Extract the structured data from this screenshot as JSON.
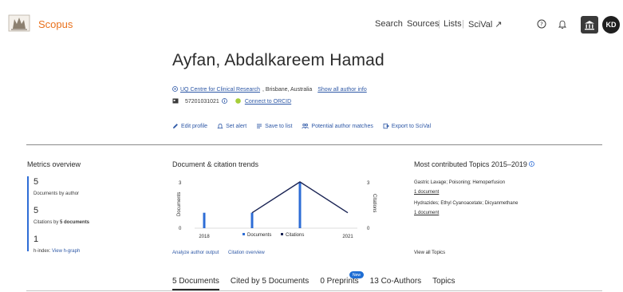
{
  "header": {
    "logo_text": "Scopus",
    "nav": [
      {
        "label": "Search"
      },
      {
        "label": "Sources"
      },
      {
        "label": "Lists"
      },
      {
        "label": "SciVal ↗"
      }
    ],
    "avatar_initials": "KD",
    "accent_color": "#e9711c",
    "icons": [
      "help-icon",
      "bell-icon",
      "institution-icon"
    ]
  },
  "author": {
    "name": "Ayfan, Abdalkareem Hamad",
    "affiliation_link": "UQ Centre for Clinical Research",
    "affiliation_place": ", Brisbane, Australia",
    "show_all_info": "Show all author info",
    "author_id": "57201031021",
    "orcid": "Connect to ORCID"
  },
  "actions": {
    "edit": "Edit profile",
    "alert": "Set alert",
    "save": "Save to list",
    "matches": "Potential author matches",
    "export": "Export to SciVal"
  },
  "metrics": {
    "title": "Metrics overview",
    "docs_value": "5",
    "docs_label": "Documents by author",
    "cites_value": "5",
    "cites_label_prefix": "Citations by ",
    "cites_label_bold": "5 documents",
    "h_value": "1",
    "h_label": "h-index:",
    "h_link": "View h-graph"
  },
  "trends": {
    "title": "Document & citation trends",
    "analyze_link": "Analyze author output",
    "citation_link": "Citation overview"
  },
  "chart_data": {
    "type": "bar",
    "categories": [
      "2018",
      "2019",
      "2020",
      "2021"
    ],
    "series": [
      {
        "name": "Documents",
        "values": [
          1,
          1,
          3,
          0
        ],
        "color": "#2e6dd6"
      },
      {
        "name": "Citations",
        "values": [
          0,
          1,
          3,
          1
        ],
        "color": "#1a2454"
      }
    ],
    "x_tick_labels": [
      "2018",
      "2021"
    ],
    "ylabel": "Documents",
    "y2label": "Citations",
    "ylim": [
      0,
      3
    ],
    "y2lim": [
      0,
      3
    ],
    "y_ticks": [
      "3",
      "0"
    ],
    "y2_ticks": [
      "3",
      "0"
    ],
    "legend": "bottom"
  },
  "topics": {
    "title": "Most contributed Topics 2015–2019",
    "items": [
      {
        "name": "Gastric Lavage; Poisoning; Hemoperfusion",
        "docs": "1 document"
      },
      {
        "name": "Hydrazides; Ethyl Cyanoacetate; Dicyanmethane",
        "docs": "1 document"
      }
    ],
    "view_all": "View all Topics"
  },
  "tabs": [
    {
      "label": "5 Documents",
      "active": true
    },
    {
      "label": "Cited by 5 Documents",
      "active": false
    },
    {
      "label": "0 Preprints",
      "active": false
    },
    {
      "label": "13 Co-Authors",
      "active": false
    },
    {
      "label": "Topics",
      "active": false
    }
  ],
  "new_badge": "New"
}
